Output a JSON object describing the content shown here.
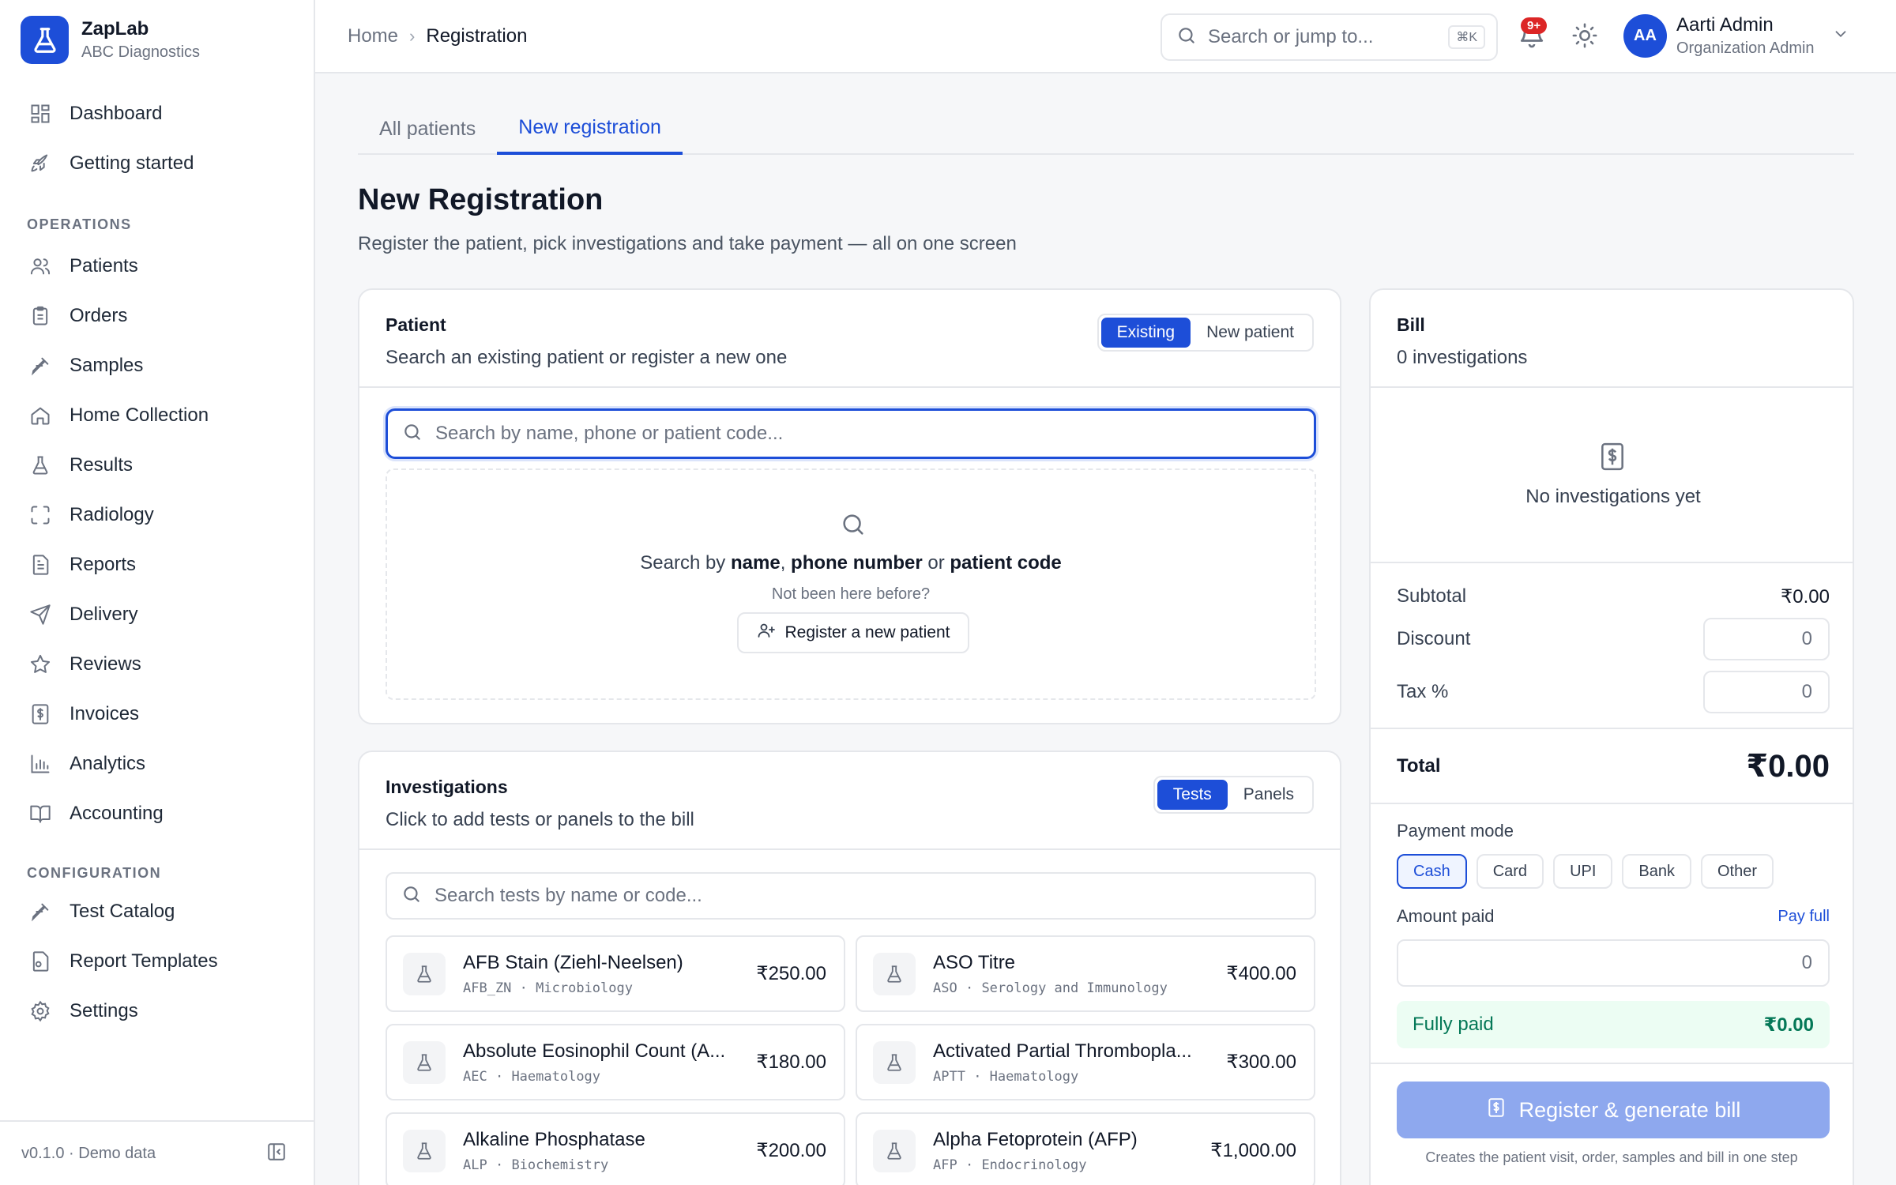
{
  "brand": {
    "name": "ZapLab",
    "subtitle": "ABC Diagnostics"
  },
  "sidebar": {
    "top_items": [
      {
        "label": "Dashboard",
        "icon": "dashboard-icon"
      },
      {
        "label": "Getting started",
        "icon": "rocket-icon"
      }
    ],
    "operations_label": "OPERATIONS",
    "operations": [
      {
        "label": "Patients",
        "icon": "users-icon"
      },
      {
        "label": "Orders",
        "icon": "clipboard-icon"
      },
      {
        "label": "Samples",
        "icon": "pipette-icon"
      },
      {
        "label": "Home Collection",
        "icon": "home-icon"
      },
      {
        "label": "Results",
        "icon": "flask-icon"
      },
      {
        "label": "Radiology",
        "icon": "scan-icon"
      },
      {
        "label": "Reports",
        "icon": "file-text-icon"
      },
      {
        "label": "Delivery",
        "icon": "send-icon"
      },
      {
        "label": "Reviews",
        "icon": "star-icon"
      },
      {
        "label": "Invoices",
        "icon": "receipt-icon"
      },
      {
        "label": "Analytics",
        "icon": "bar-chart-icon"
      },
      {
        "label": "Accounting",
        "icon": "book-icon"
      }
    ],
    "configuration_label": "CONFIGURATION",
    "configuration": [
      {
        "label": "Test Catalog",
        "icon": "pipette-icon"
      },
      {
        "label": "Report Templates",
        "icon": "file-settings-icon"
      },
      {
        "label": "Settings",
        "icon": "gear-icon"
      }
    ],
    "footer_version": "v0.1.0 · Demo data"
  },
  "topbar": {
    "breadcrumb_home": "Home",
    "breadcrumb_current": "Registration",
    "search_placeholder": "Search or jump to...",
    "search_shortcut": "⌘K",
    "notification_count": "9+",
    "user_initials": "AA",
    "user_name": "Aarti Admin",
    "user_role": "Organization Admin"
  },
  "tabs": [
    "All patients",
    "New registration"
  ],
  "active_tab": "New registration",
  "page": {
    "title": "New Registration",
    "description": "Register the patient, pick investigations and take payment — all on one screen"
  },
  "patient": {
    "title": "Patient",
    "subtitle": "Search an existing patient or register a new one",
    "toggle": [
      "Existing",
      "New patient"
    ],
    "search_placeholder": "Search by name, phone or patient code...",
    "empty_prefix": "Search by",
    "empty_name": "name",
    "empty_comma": ",",
    "empty_phone": "phone number",
    "empty_or": "or",
    "empty_code": "patient code",
    "empty_hint": "Not been here before?",
    "register_button": "Register a new patient"
  },
  "investigations": {
    "title": "Investigations",
    "subtitle": "Click to add tests or panels to the bill",
    "toggle": [
      "Tests",
      "Panels"
    ],
    "search_placeholder": "Search tests by name or code...",
    "tests": [
      {
        "name": "AFB Stain (Ziehl-Neelsen)",
        "code": "AFB_ZN",
        "dept": "Microbiology",
        "price": "₹250.00"
      },
      {
        "name": "ASO Titre",
        "code": "ASO",
        "dept": "Serology and Immunology",
        "price": "₹400.00"
      },
      {
        "name": "Absolute Eosinophil Count (A...",
        "code": "AEC",
        "dept": "Haematology",
        "price": "₹180.00"
      },
      {
        "name": "Activated Partial Thrombopla...",
        "code": "APTT",
        "dept": "Haematology",
        "price": "₹300.00"
      },
      {
        "name": "Alkaline Phosphatase",
        "code": "ALP",
        "dept": "Biochemistry",
        "price": "₹200.00"
      },
      {
        "name": "Alpha Fetoprotein (AFP)",
        "code": "AFP",
        "dept": "Endocrinology",
        "price": "₹1,000.00"
      }
    ]
  },
  "bill": {
    "title": "Bill",
    "count": "0 investigations",
    "empty_text": "No investigations yet",
    "subtotal_label": "Subtotal",
    "subtotal_value": "₹0.00",
    "discount_label": "Discount",
    "discount_value": "0",
    "tax_label": "Tax %",
    "tax_value": "0",
    "total_label": "Total",
    "total_value": "₹0.00",
    "payment_mode_label": "Payment mode",
    "payment_modes": [
      "Cash",
      "Card",
      "UPI",
      "Bank",
      "Other"
    ],
    "selected_mode": "Cash",
    "amount_paid_label": "Amount paid",
    "pay_full": "Pay full",
    "amount_paid_value": "0",
    "status_label": "Fully paid",
    "status_amount": "₹0.00",
    "submit_label": "Register & generate bill",
    "submit_note": "Creates the patient visit, order, samples and bill in one step"
  },
  "colors": {
    "accent": "#1d4ed8",
    "success": "#047857",
    "danger": "#dc2626"
  }
}
